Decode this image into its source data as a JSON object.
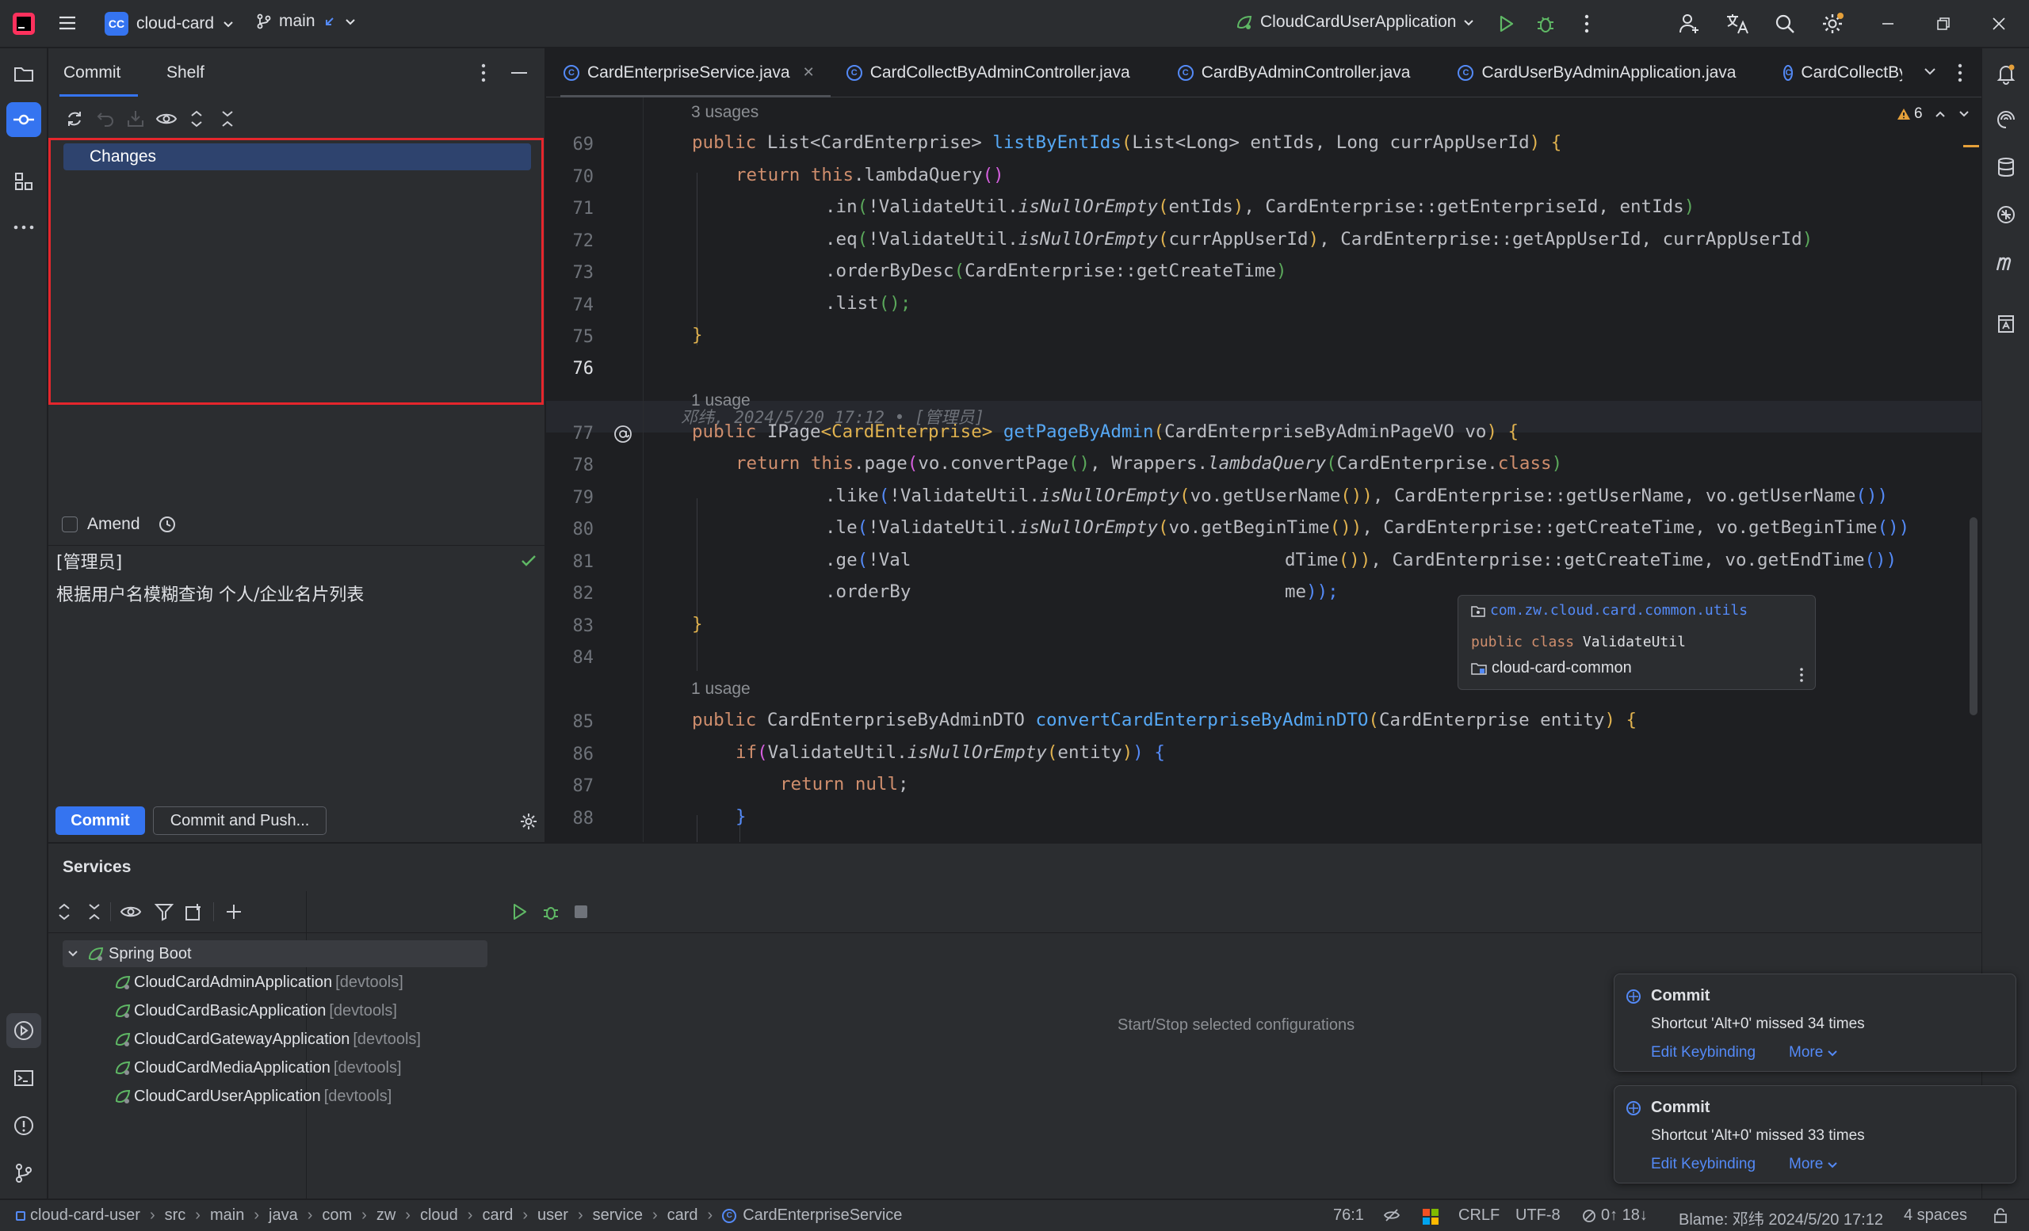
{
  "titlebar": {
    "project_badge": "CC",
    "project_name": "cloud-card",
    "branch": "main",
    "run_config": "CloudCardUserApplication"
  },
  "commit_panel": {
    "tabs": [
      "Commit",
      "Shelf"
    ],
    "changes_label": "Changes",
    "amend_label": "Amend",
    "message_line1": "[管理员]",
    "message_line2": "根据用户名模糊查询 个人/企业名片列表",
    "commit_button": "Commit",
    "commit_push_button": "Commit and Push..."
  },
  "editor": {
    "tabs": [
      "CardEnterpriseService.java",
      "CardCollectByAdminController.java",
      "CardByAdminController.java",
      "CardUserByAdminApplication.java",
      "CardCollectBy"
    ],
    "warnings_count": "6",
    "usages": {
      "u69": "3 usages",
      "u77": "1 usage",
      "u85": "1 usage"
    },
    "line_numbers": [
      "69",
      "70",
      "71",
      "72",
      "73",
      "74",
      "75",
      "76",
      "77",
      "78",
      "79",
      "80",
      "81",
      "82",
      "83",
      "84",
      "85",
      "86",
      "87",
      "88"
    ],
    "blame_line": "邓纬, 2024/5/20 17:12 • [管理员]",
    "code": {
      "l69a": "public ",
      "l69b": "List",
      "l69c": "<CardEnterprise> ",
      "l69d": "listByEntIds",
      "l69e": "(",
      "l69f": "List<Long> entIds, Long currAppUserId",
      "l69g": ") {",
      "l70a": "return this",
      "l70b": ".lambdaQuery",
      "l70c": "()",
      "l71a": ".in",
      "l71b": "(",
      "l71c": "!ValidateUtil.",
      "l71d": "isNullOrEmpty",
      "l71e": "(",
      "l71f": "entIds",
      "l71g": ")",
      "l71h": ", CardEnterprise::getEnterpriseId, entIds",
      "l71i": ")",
      "l72a": ".eq",
      "l72b": "(",
      "l72c": "!ValidateUtil.",
      "l72d": "isNullOrEmpty",
      "l72e": "(",
      "l72f": "currAppUserId",
      "l72g": ")",
      "l72h": ", CardEnterprise::getAppUserId, currAppUserId",
      "l72i": ")",
      "l73a": ".orderByDesc",
      "l73b": "(",
      "l73c": "CardEnterprise::getCreateTime",
      "l73d": ")",
      "l74a": ".list",
      "l74b": "();",
      "l75": "}",
      "l77a": "public ",
      "l77b": "IPage",
      "l77c": "<CardEnterprise> ",
      "l77d": "getPageByAdmin",
      "l77e": "(",
      "l77f": "CardEnterpriseByAdminPageVO vo",
      "l77g": ") {",
      "l78a": "return this",
      "l78b": ".page",
      "l78c": "(",
      "l78d": "vo.convertPage",
      "l78e": "()",
      "l78f": ", Wrappers.",
      "l78g": "lambdaQuery",
      "l78h": "(",
      "l78i": "CardEnterprise.",
      "l78j": "class",
      "l78k": ")",
      "l79a": ".like",
      "l79b": "(",
      "l79c": "!ValidateUtil.",
      "l79d": "isNullOrEmpty",
      "l79e": "(",
      "l79f": "vo.getUserName",
      "l79g": "())",
      "l79h": ", CardEnterprise::getUserName, vo.getUserName",
      "l79i": "())",
      "l80a": ".le",
      "l80b": "(",
      "l80c": "!ValidateUtil.",
      "l80d": "isNullOrEmpty",
      "l80e": "(",
      "l80f": "vo.getBeginTime",
      "l80g": "())",
      "l80h": ", CardEnterprise::getCreateTime, vo.getBeginTime",
      "l80i": "())",
      "l81a": ".ge",
      "l81b": "(",
      "l81c": "!Val",
      "l81d": "dTime",
      "l81e": "())",
      "l81f": ", CardEnterprise::getCreateTime, vo.getEndTime",
      "l81g": "())",
      "l82a": ".orderBy",
      "l82b": "me",
      "l82c": "));",
      "l83": "}",
      "l85a": "public ",
      "l85b": "CardEnterpriseByAdminDTO ",
      "l85c": "convertCardEnterpriseByAdminDTO",
      "l85d": "(",
      "l85e": "CardEnterprise entity",
      "l85f": ") {",
      "l86a": "if",
      "l86b": "(",
      "l86c": "ValidateUtil.",
      "l86d": "isNullOrEmpty",
      "l86e": "(",
      "l86f": "entity",
      "l86g": ")",
      "l86h": ") {",
      "l87a": "return null",
      "l87b": ";",
      "l88": "}"
    },
    "popup": {
      "package": "com.zw.cloud.card.common.utils",
      "decl_kw": "public class ",
      "decl_name": "ValidateUtil",
      "module": "cloud-card-common"
    }
  },
  "services": {
    "title": "Services",
    "root": "Spring Boot",
    "apps": [
      {
        "name": "CloudCardAdminApplication",
        "tag": "[devtools]"
      },
      {
        "name": "CloudCardBasicApplication",
        "tag": "[devtools]"
      },
      {
        "name": "CloudCardGatewayApplication",
        "tag": "[devtools]"
      },
      {
        "name": "CloudCardMediaApplication",
        "tag": "[devtools]"
      },
      {
        "name": "CloudCardUserApplication",
        "tag": "[devtools]"
      }
    ],
    "placeholder": "Start/Stop selected configurations",
    "notifications": [
      {
        "title": "Commit",
        "body": "Shortcut 'Alt+0' missed 34 times",
        "link": "Edit Keybinding",
        "more": "More"
      },
      {
        "title": "Commit",
        "body": "Shortcut 'Alt+0' missed 33 times",
        "link": "Edit Keybinding",
        "more": "More"
      }
    ]
  },
  "statusbar": {
    "breadcrumbs": [
      "cloud-card-user",
      "src",
      "main",
      "java",
      "com",
      "zw",
      "cloud",
      "card",
      "user",
      "service",
      "card",
      "CardEnterpriseService"
    ],
    "position": "76:1",
    "line_sep": "CRLF",
    "encoding": "UTF-8",
    "git": "0↑ 18↓",
    "blame": "Blame: 邓纬 2024/5/20 17:12",
    "indent": "4 spaces"
  },
  "colors": {
    "accent": "#3574f0",
    "highlight_border": "#e5262c",
    "keyword": "#cf8e6d",
    "function": "#56a8f5"
  }
}
